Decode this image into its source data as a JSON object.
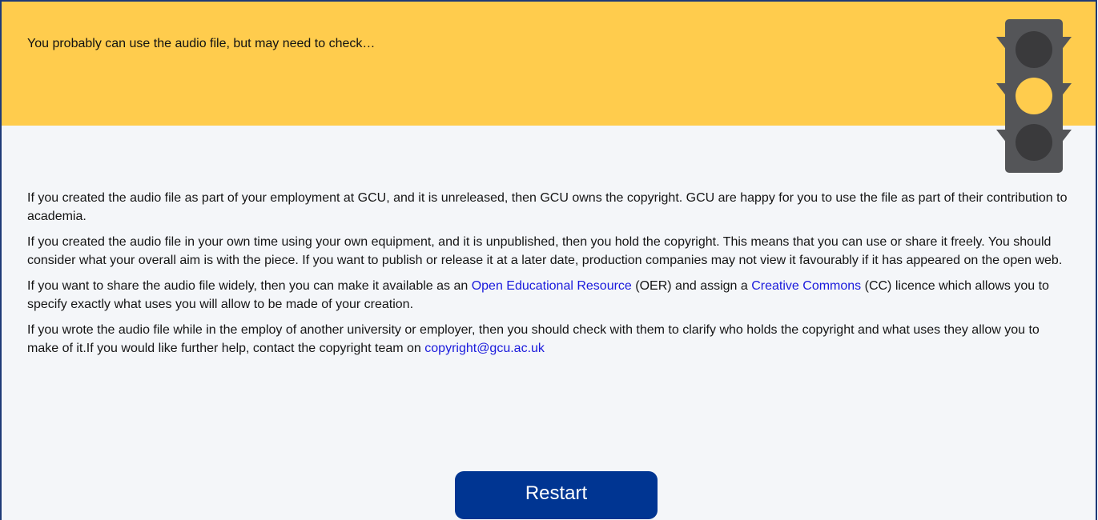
{
  "banner": {
    "message": "You probably can use the audio file, but may need to check…",
    "color": "#ffcc4d"
  },
  "traffic_light": {
    "active_signal": "amber",
    "lamp_colors": {
      "red": "#3a3a3c",
      "amber": "#ffcc4d",
      "green": "#3a3a3c"
    },
    "body_color": "#545558"
  },
  "content": {
    "para1": "If you created the audio file as part of your employment at GCU, and it is unreleased, then GCU owns the copyright. GCU are happy for you to use the file as part of their contribution to academia.",
    "para2": "If you created the audio file in your own time using your own equipment, and it is unpublished, then you hold the copyright. This means that you can use or share it freely. You should consider what your overall aim is with the piece. If you want to publish or release it at a later date, production companies may not view it favourably if it has appeared on the open web.",
    "para3": {
      "text_1": "If you want to share the audio file widely, then you can make it available as an ",
      "oer_link": "Open Educational Resource",
      "text_2": " (OER) and assign a ",
      "cc_link": "Creative Commons",
      "text_3": " (CC) licence which allows you to specify exactly what uses you will allow to be made of your creation."
    },
    "para4": {
      "text_1": "If you wrote the audio file while in the employ of another university or employer, then you should check with them to clarify who holds the copyright and what uses they allow you to make of it.If you would like further help, contact the copyright team on ",
      "email_link": "copyright@gcu.ac.uk"
    },
    "link_color": "#1a1adc"
  },
  "restart_button": {
    "label": "Restart",
    "color": "#003592"
  }
}
